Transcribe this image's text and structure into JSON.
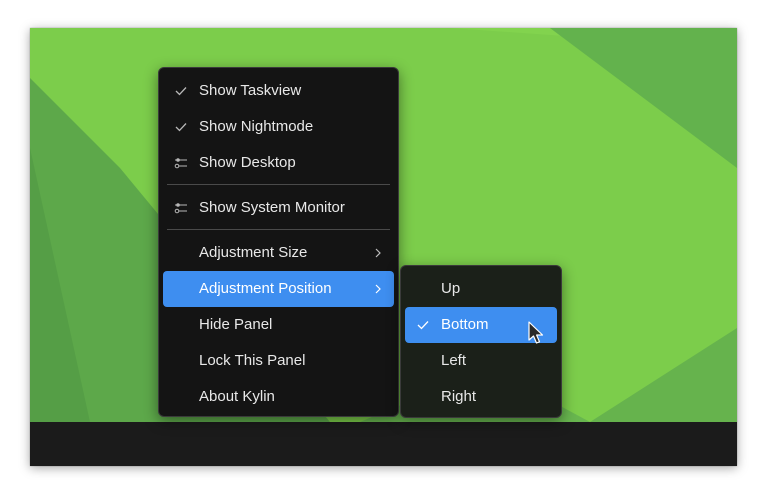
{
  "colors": {
    "wallpaper_light": "#80d24c",
    "wallpaper_dark": "#5fae4a",
    "menu_bg": "#141414",
    "highlight": "#3e8ef0",
    "taskbar": "#1b1b1b"
  },
  "context_menu": {
    "items": [
      {
        "label": "Show Taskview",
        "icon": "check-icon"
      },
      {
        "label": "Show Nightmode",
        "icon": "check-icon"
      },
      {
        "label": "Show Desktop",
        "icon": "slider-toggle-icon"
      },
      {
        "label": "Show System Monitor",
        "icon": "slider-toggle-icon"
      },
      {
        "label": "Adjustment Size",
        "icon": "chevron-right-icon"
      },
      {
        "label": "Adjustment Position",
        "icon": "chevron-right-icon",
        "highlighted": true
      },
      {
        "label": "Hide Panel"
      },
      {
        "label": "Lock This Panel"
      },
      {
        "label": "About Kylin"
      }
    ]
  },
  "submenu": {
    "items": [
      {
        "label": "Up"
      },
      {
        "label": "Bottom",
        "icon": "check-icon",
        "highlighted": true
      },
      {
        "label": "Left"
      },
      {
        "label": "Right"
      }
    ]
  }
}
